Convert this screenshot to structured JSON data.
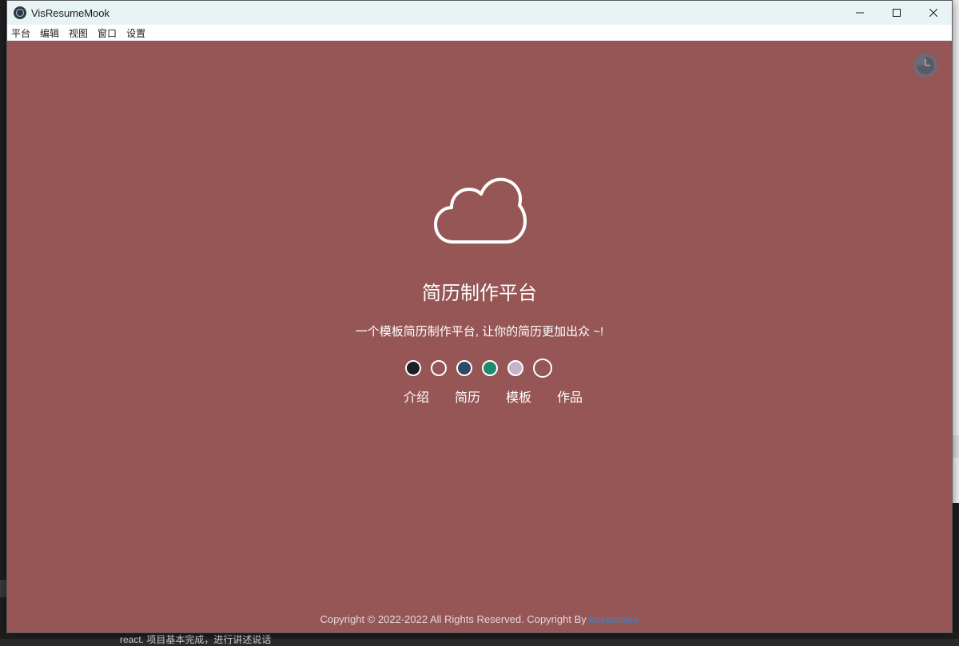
{
  "window": {
    "title": "VisResumeMook",
    "controls": {
      "minimize": "—",
      "maximize": "☐",
      "close": "✕"
    }
  },
  "menu": [
    "平台",
    "编辑",
    "视图",
    "窗口",
    "设置"
  ],
  "theme_toggle_icon": "clock-icon",
  "hero": {
    "icon": "cloud-icon",
    "title": "简历制作平台",
    "subtitle": "一个模板简历制作平台, 让你的简历更加出众 ~!"
  },
  "theme_colors": [
    "#1d1f26",
    "#965656",
    "#2d4a66",
    "#1f8a6c",
    "#c7b3c8",
    "#965656"
  ],
  "nav": [
    "介绍",
    "简历",
    "模板",
    "作品"
  ],
  "footer": {
    "text": "Copyright © 2022-2022 All Rights Reserved. Copyright By ",
    "author": "kakashake"
  },
  "desktop": {
    "bottom_text": "react. 项目基本完成，进行讲述说话"
  },
  "colors": {
    "background": "#965656",
    "titlebar": "#e8f3f6",
    "text": "#ffffff",
    "link": "#3b82c4"
  }
}
